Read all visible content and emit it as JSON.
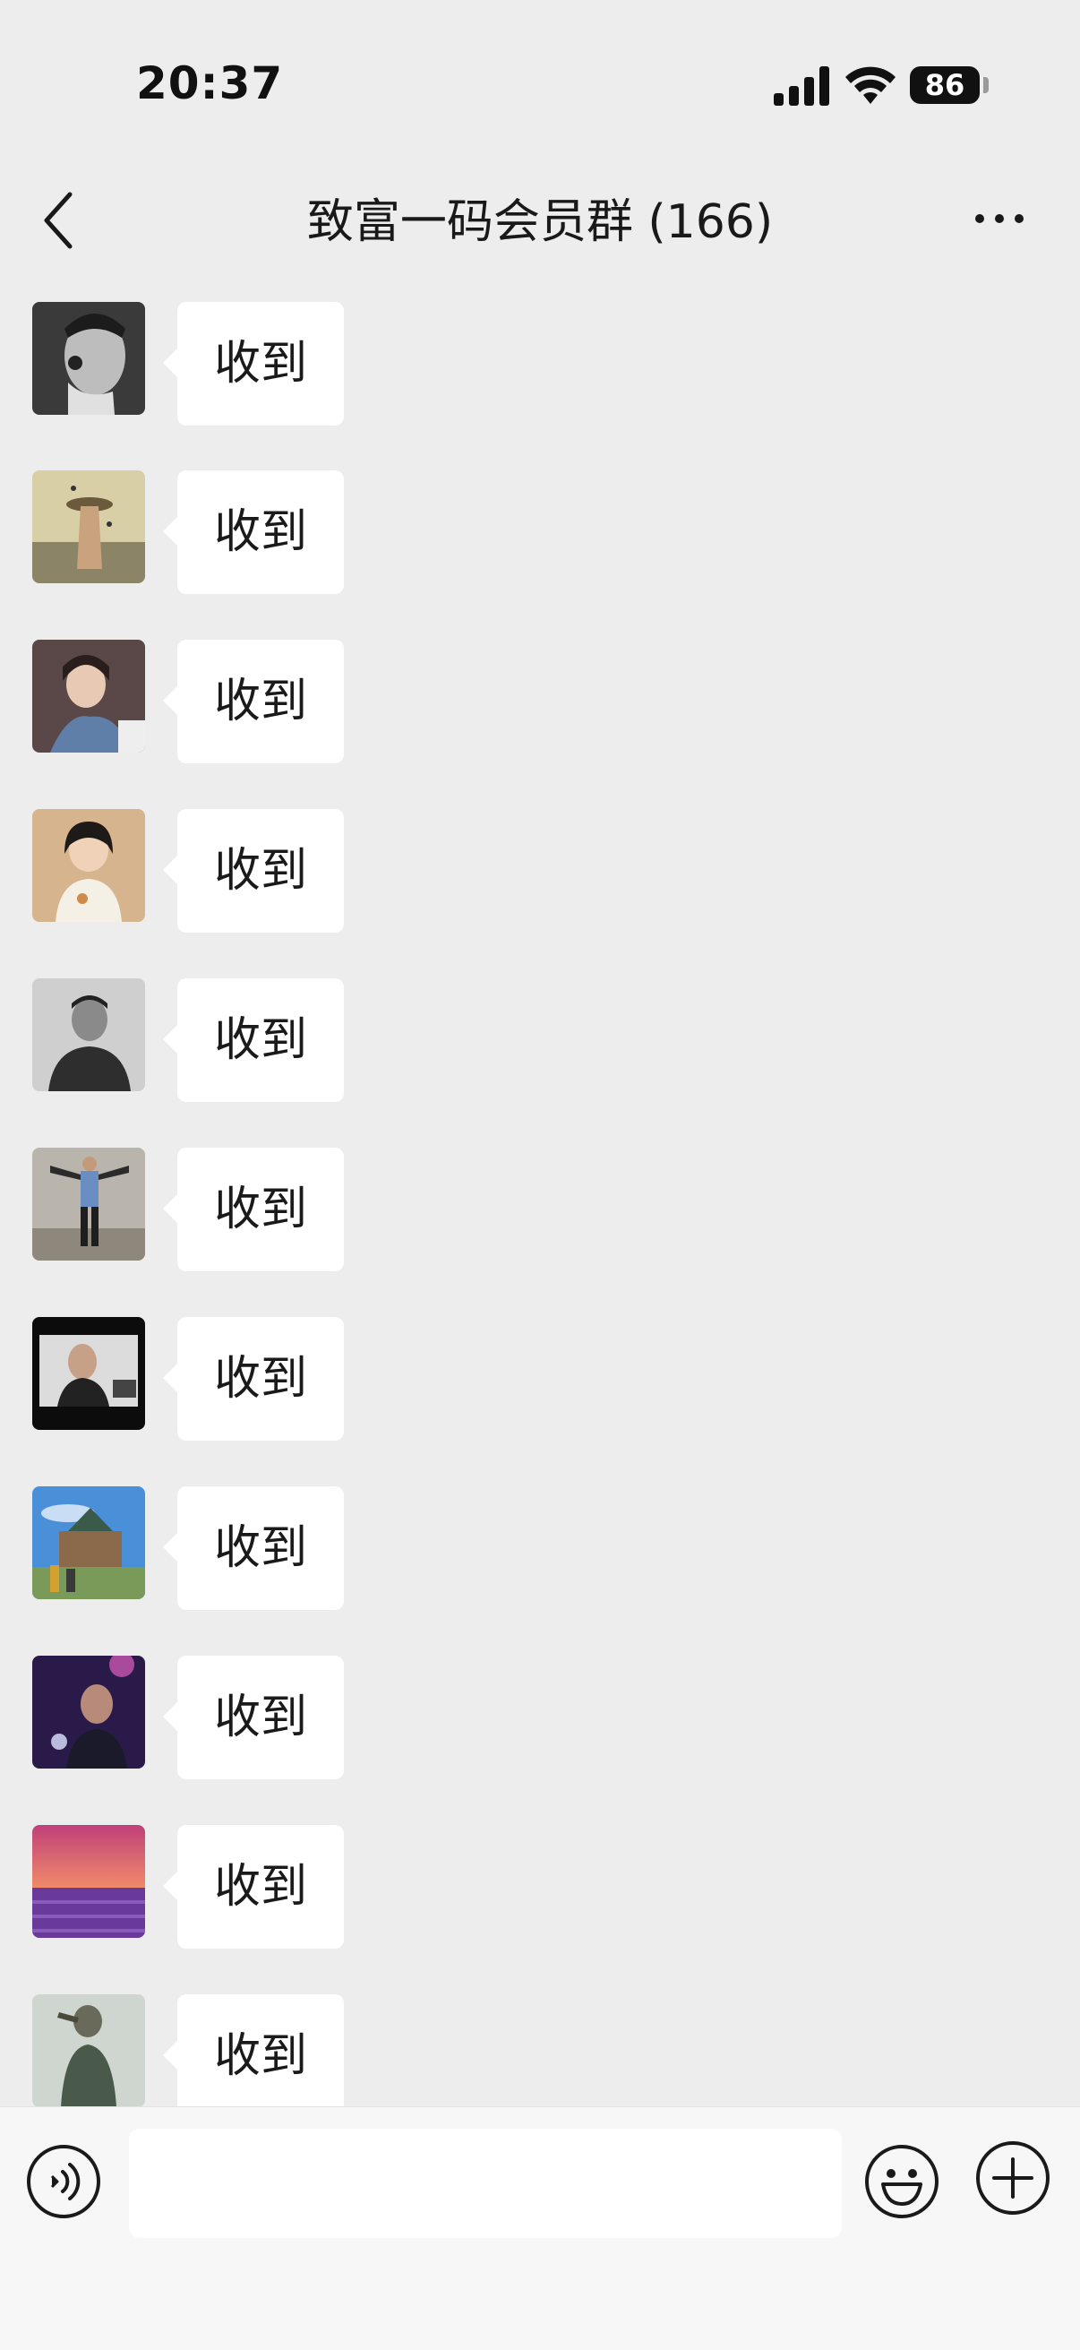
{
  "status_bar": {
    "time": "20:37",
    "battery_level": "86"
  },
  "nav": {
    "title": "致富一码会员群 (166)",
    "back_icon": "chevron-left-icon",
    "more_icon": "ellipsis-icon"
  },
  "messages": [
    {
      "text": "收到",
      "avatar": "avatar-tattooed-man-bw"
    },
    {
      "text": "收到",
      "avatar": "avatar-woman-hat-beach"
    },
    {
      "text": "收到",
      "avatar": "avatar-girl-denim"
    },
    {
      "text": "收到",
      "avatar": "avatar-girl-bob-hair"
    },
    {
      "text": "收到",
      "avatar": "avatar-man-bw-portrait"
    },
    {
      "text": "收到",
      "avatar": "avatar-man-arms-spread"
    },
    {
      "text": "收到",
      "avatar": "avatar-man-dark-room"
    },
    {
      "text": "收到",
      "avatar": "avatar-castle-landscape"
    },
    {
      "text": "收到",
      "avatar": "avatar-man-purple-light"
    },
    {
      "text": "收到",
      "avatar": "avatar-lavender-field"
    },
    {
      "text": "收到",
      "avatar": "avatar-man-saluting"
    }
  ],
  "input_bar": {
    "placeholder": "",
    "voice_icon": "voice-icon",
    "emoji_icon": "emoji-icon",
    "plus_icon": "plus-circle-icon"
  },
  "colors": {
    "background": "#ededed",
    "bubble": "#ffffff",
    "input_bar": "#f7f7f7"
  }
}
